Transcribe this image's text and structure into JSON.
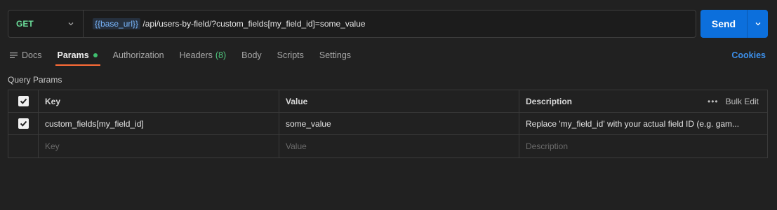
{
  "request": {
    "method": "GET",
    "url_variable": "{{base_url}}",
    "url_path": " /api/users-by-field/?custom_fields[my_field_id]=some_value",
    "send_label": "Send"
  },
  "tabs": [
    {
      "label": "Docs"
    },
    {
      "label": "Params"
    },
    {
      "label": "Authorization"
    },
    {
      "label": "Headers",
      "count": "(8)"
    },
    {
      "label": "Body"
    },
    {
      "label": "Scripts"
    },
    {
      "label": "Settings"
    }
  ],
  "cookies_label": "Cookies",
  "query_params": {
    "title": "Query Params",
    "headers": {
      "key": "Key",
      "value": "Value",
      "description": "Description",
      "bulk_edit": "Bulk Edit"
    },
    "rows": [
      {
        "checked": true,
        "key": "custom_fields[my_field_id]",
        "value": "some_value",
        "description": "Replace 'my_field_id' with your actual field ID (e.g. gam..."
      }
    ],
    "placeholder": {
      "key": "Key",
      "value": "Value",
      "description": "Description"
    }
  },
  "colors": {
    "accent": "#0c6fdc",
    "method": "#6bdd9a",
    "active_tab_underline": "#ff6c37",
    "link": "#3c8fea"
  }
}
